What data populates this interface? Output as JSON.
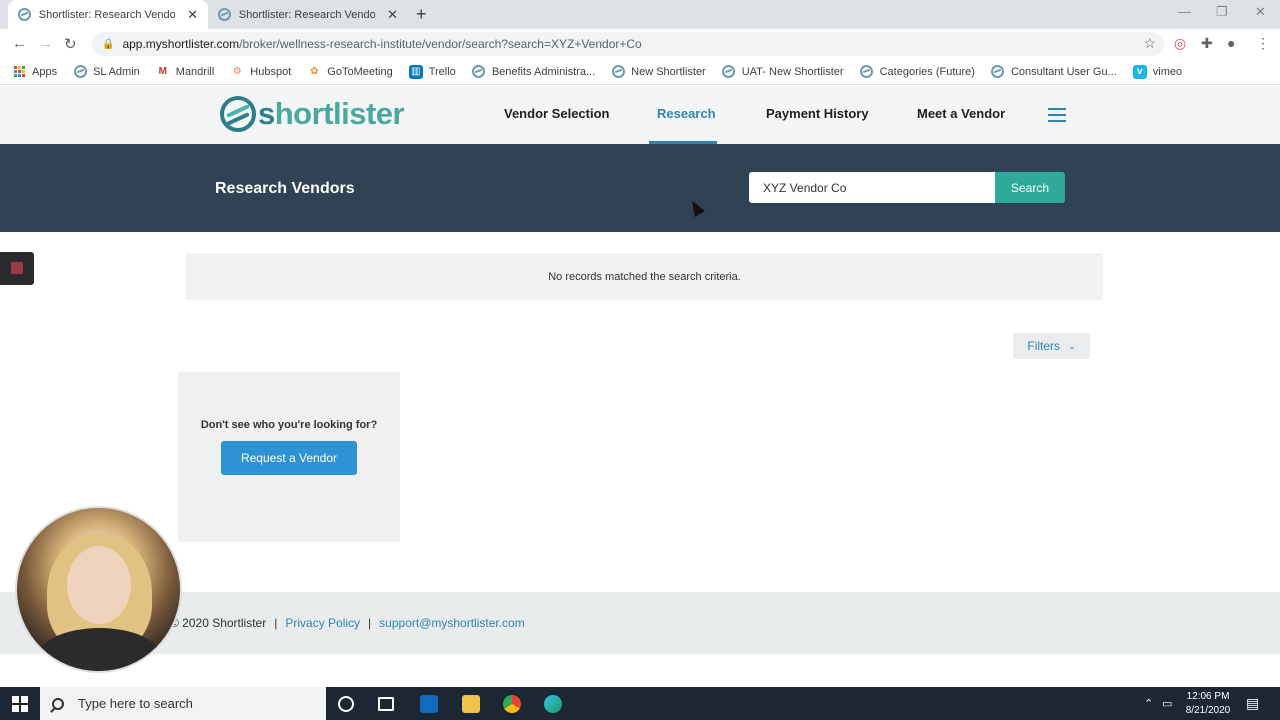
{
  "browser": {
    "tabs": [
      {
        "title": "Shortlister: Research Vendors",
        "active": true
      },
      {
        "title": "Shortlister: Research Vendors",
        "active": false
      }
    ],
    "new_tab_label": "+",
    "url_host": "app.myshortlister.com",
    "url_path": "/broker/wellness-research-institute/vendor/search?search=XYZ+Vendor+Co",
    "bookmarks": [
      {
        "label": "Apps",
        "icon": "apps-grid-icon"
      },
      {
        "label": "SL Admin",
        "icon": "shortlister-icon"
      },
      {
        "label": "Mandrill",
        "icon": "mandrill-icon"
      },
      {
        "label": "Hubspot",
        "icon": "hubspot-icon"
      },
      {
        "label": "GoToMeeting",
        "icon": "gotomeeting-icon"
      },
      {
        "label": "Trello",
        "icon": "trello-icon"
      },
      {
        "label": "Benefits Administra...",
        "icon": "shortlister-icon"
      },
      {
        "label": "New Shortlister",
        "icon": "shortlister-icon"
      },
      {
        "label": "UAT- New Shortlister",
        "icon": "shortlister-icon"
      },
      {
        "label": "Categories (Future)",
        "icon": "shortlister-icon"
      },
      {
        "label": "Consultant User Gu...",
        "icon": "shortlister-icon"
      },
      {
        "label": "vimeo",
        "icon": "vimeo-icon"
      }
    ]
  },
  "site": {
    "logo_part1": "s",
    "logo_part2": "hortlister",
    "nav": [
      {
        "label": "Vendor Selection",
        "active": false
      },
      {
        "label": "Research",
        "active": true
      },
      {
        "label": "Payment History",
        "active": false
      },
      {
        "label": "Meet a Vendor",
        "active": false
      }
    ],
    "accent_color": "#2e86b8",
    "search_button_color": "#2fa99a"
  },
  "hero": {
    "title": "Research Vendors",
    "search_value": "XYZ Vendor Co",
    "search_button": "Search"
  },
  "results": {
    "message": "No records matched the search criteria.",
    "filters_label": "Filters"
  },
  "card": {
    "prompt": "Don't see who you're looking for?",
    "button": "Request a Vendor"
  },
  "footer": {
    "copyright": "© 2020 Shortlister",
    "sep": "|",
    "privacy": "Privacy Policy",
    "email": "support@myshortlister.com"
  },
  "taskbar": {
    "search_placeholder": "Type here to search",
    "time": "12:06 PM",
    "date": "8/21/2020"
  }
}
